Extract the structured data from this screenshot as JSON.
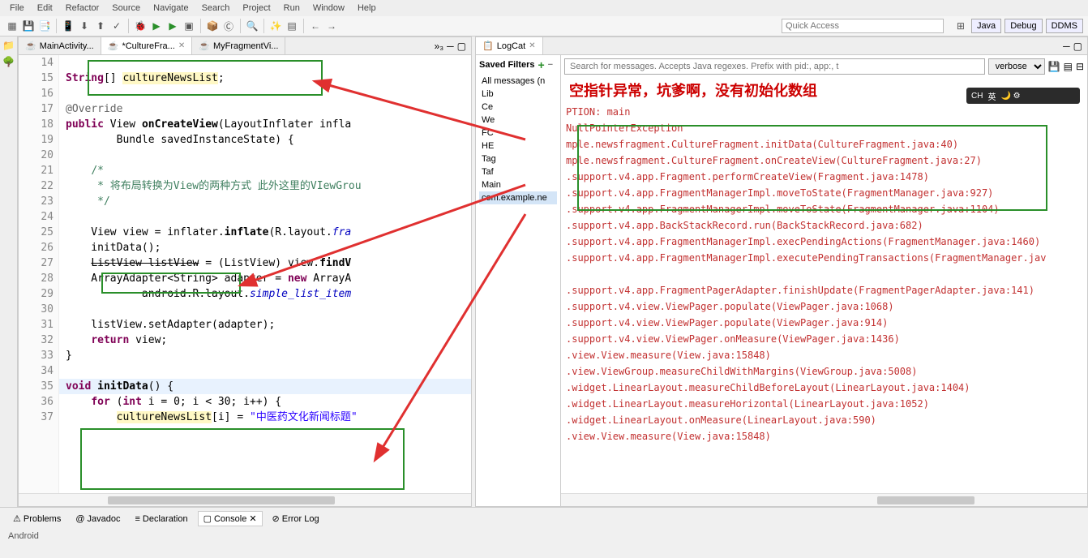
{
  "menu": [
    "File",
    "Edit",
    "Refactor",
    "Source",
    "Navigate",
    "Search",
    "Project",
    "Run",
    "Window",
    "Help"
  ],
  "quick_access_placeholder": "Quick Access",
  "perspectives": [
    "Java",
    "Debug",
    "DDMS"
  ],
  "editor_tabs": [
    {
      "label": "MainActivity...",
      "active": false
    },
    {
      "label": "*CultureFra...",
      "active": true
    },
    {
      "label": "MyFragmentVi...",
      "active": false
    }
  ],
  "more_tabs": "»₃",
  "code_lines": [
    {
      "n": 14,
      "html": ""
    },
    {
      "n": 15,
      "html": "<span class='kw'>String</span>[] <span class='field-hl'>cultureNewsList</span>;"
    },
    {
      "n": 16,
      "html": ""
    },
    {
      "n": 17,
      "html": "<span class='ann'>@Override</span>"
    },
    {
      "n": 18,
      "html": "<span class='kw'>public</span> View <span class='type'>onCreateView</span>(LayoutInflater infla"
    },
    {
      "n": 19,
      "html": "        Bundle savedInstanceState) {"
    },
    {
      "n": 20,
      "html": ""
    },
    {
      "n": 21,
      "html": "    <span class='cmt'>/*</span>"
    },
    {
      "n": 22,
      "html": "    <span class='cmt'> * 将布局转换为View的两种方式 此外这里的VIewGrou</span>"
    },
    {
      "n": 23,
      "html": "    <span class='cmt'> */</span>"
    },
    {
      "n": 24,
      "html": ""
    },
    {
      "n": 25,
      "html": "    View view = inflater.<span class='type'>inflate</span>(R.layout.<span style='font-style:italic;color:#0000c0'>fra</span>"
    },
    {
      "n": 26,
      "html": "    initData();"
    },
    {
      "n": 27,
      "html": "    <span style='text-decoration:line-through'>ListView listView</span> = (ListView) view.<span class='type'>findV</span>"
    },
    {
      "n": 28,
      "html": "    ArrayAdapter&lt;String&gt; adapter = <span class='kw'>new</span> ArrayA"
    },
    {
      "n": 29,
      "html": "            android.R.layout.<span style='font-style:italic;color:#0000c0'>simple_list_item</span>"
    },
    {
      "n": 30,
      "html": ""
    },
    {
      "n": 31,
      "html": "    listView.setAdapter(adapter);"
    },
    {
      "n": 32,
      "html": "    <span class='kw'>return</span> view;"
    },
    {
      "n": 33,
      "html": "}"
    },
    {
      "n": 34,
      "html": ""
    },
    {
      "n": 35,
      "html": "<span class='kw'>void</span> <span class='type'>initData</span>() {",
      "current": true
    },
    {
      "n": 36,
      "html": "    <span class='kw'>for</span> (<span class='kw'>int</span> i = 0; i &lt; 30; i++) {"
    },
    {
      "n": 37,
      "html": "        <span class='field-hl'>cultureNewsList</span>[i] = <span class='str'>\"中医药文化新闻标题\"</span>"
    }
  ],
  "logcat": {
    "title": "LogCat",
    "filters_title": "Saved Filters",
    "filters": [
      "All messages (n",
      "Lib",
      "Ce",
      "We",
      "FC",
      "HE",
      "Tag",
      "Taf",
      "Main",
      "com.example.ne"
    ],
    "search_placeholder": "Search for messages. Accepts Java regexes. Prefix with pid:, app:, t",
    "level": "verbose",
    "annotation": "空指针异常，坑爹啊，没有初始化数组",
    "lines": [
      "PTION: main",
      "NullPointerException",
      "mple.newsfragment.CultureFragment.initData(CultureFragment.java:40)",
      "mple.newsfragment.CultureFragment.onCreateView(CultureFragment.java:27)",
      ".support.v4.app.Fragment.performCreateView(Fragment.java:1478)",
      ".support.v4.app.FragmentManagerImpl.moveToState(FragmentManager.java:927)",
      ".support.v4.app.FragmentManagerImpl.moveToState(FragmentManager.java:1104)",
      ".support.v4.app.BackStackRecord.run(BackStackRecord.java:682)",
      ".support.v4.app.FragmentManagerImpl.execPendingActions(FragmentManager.java:1460)",
      ".support.v4.app.FragmentManagerImpl.executePendingTransactions(FragmentManager.jav",
      "",
      ".support.v4.app.FragmentPagerAdapter.finishUpdate(FragmentPagerAdapter.java:141)",
      ".support.v4.view.ViewPager.populate(ViewPager.java:1068)",
      ".support.v4.view.ViewPager.populate(ViewPager.java:914)",
      ".support.v4.view.ViewPager.onMeasure(ViewPager.java:1436)",
      ".view.View.measure(View.java:15848)",
      ".view.ViewGroup.measureChildWithMargins(ViewGroup.java:5008)",
      ".widget.LinearLayout.measureChildBeforeLayout(LinearLayout.java:1404)",
      ".widget.LinearLayout.measureHorizontal(LinearLayout.java:1052)",
      ".widget.LinearLayout.onMeasure(LinearLayout.java:590)",
      ".view.View.measure(View.java:15848)"
    ]
  },
  "bottom_tabs": [
    {
      "label": "Problems",
      "icon": "⚠"
    },
    {
      "label": "Javadoc",
      "icon": "@"
    },
    {
      "label": "Declaration",
      "icon": "≡"
    },
    {
      "label": "Console",
      "icon": "▢",
      "active": true
    },
    {
      "label": "Error Log",
      "icon": "⊘"
    }
  ],
  "bottom_status": "Android",
  "ime": {
    "lang": "CH",
    "mode": "英",
    "icons": "🌙 ⚙"
  }
}
